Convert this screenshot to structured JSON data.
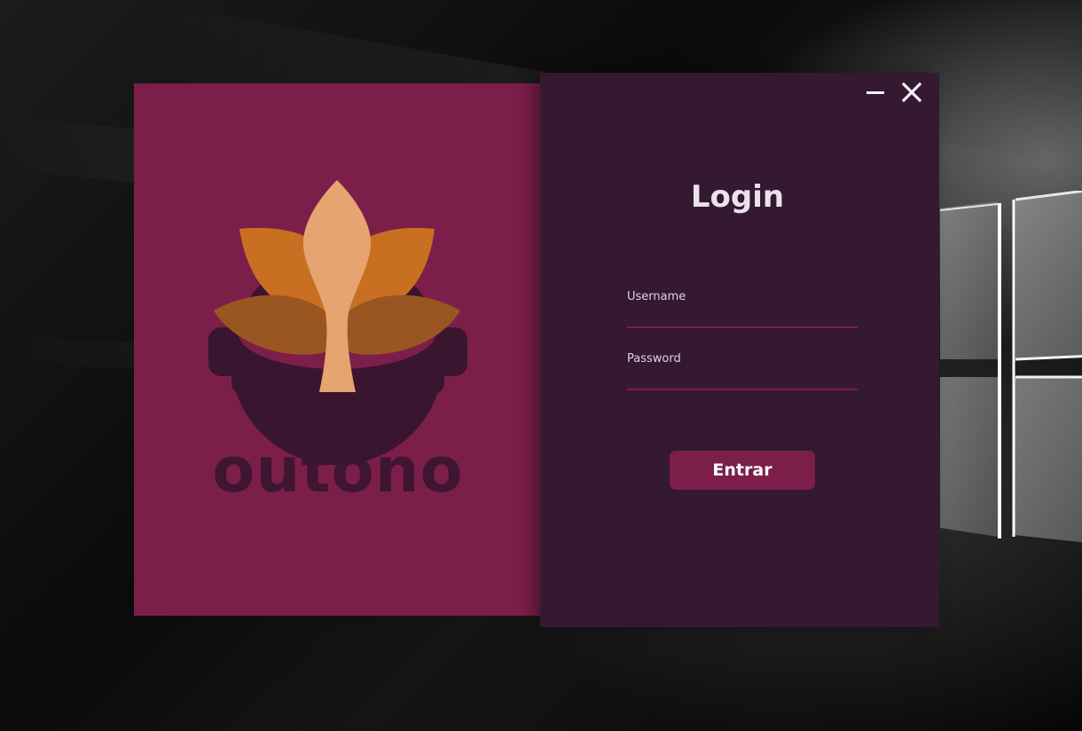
{
  "brand": {
    "name": "outono",
    "logo_icon": "autumn-leaf-gear-logo"
  },
  "window": {
    "minimize_icon": "minimize-icon",
    "close_icon": "close-icon"
  },
  "login": {
    "title": "Login",
    "username_label": "Username",
    "username_value": "",
    "password_label": "Password",
    "password_value": "",
    "submit_label": "Entrar"
  },
  "colors": {
    "brand_panel": "#7b1f4a",
    "login_panel": "#351832",
    "accent": "#7b1f4a",
    "leaf_light": "#e6a570",
    "leaf_orange": "#c96f22",
    "gear": "#3a1530"
  }
}
